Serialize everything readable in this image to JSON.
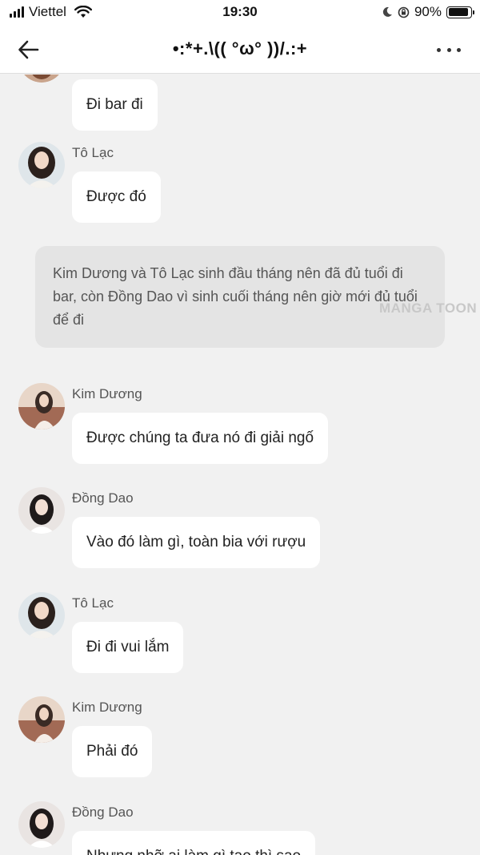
{
  "status_bar": {
    "carrier": "Viettel",
    "time": "19:30",
    "battery": "90%",
    "battery_level": 0.9
  },
  "header": {
    "title": "•:*+.\\(( °ω° ))/.:+"
  },
  "messages": [
    {
      "sender": "",
      "text": "Đi bar đi"
    },
    {
      "sender": "Tô Lạc",
      "text": "Được đó"
    },
    {
      "narration": "Kim Dương và Tô Lạc sinh đầu tháng nên đã đủ tuổi đi bar, còn Đồng Dao vì sinh cuối tháng nên giờ mới đủ tuổi để đi"
    },
    {
      "sender": "Kim Dương",
      "text": "Được chúng ta đưa nó đi giải ngố"
    },
    {
      "sender": "Đồng Dao",
      "text": "Vào đó làm gì, toàn bia với rượu"
    },
    {
      "sender": "Tô Lạc",
      "text": "Đi đi vui lắm"
    },
    {
      "sender": "Kim Dương",
      "text": "Phải đó"
    },
    {
      "sender": "Đồng Dao",
      "text": "Nhưng nhỡ ai làm gì tao thì sao"
    }
  ],
  "watermark": "MANGA TOON",
  "colors": {
    "background": "#f1f1f1",
    "bubble": "#ffffff",
    "narration": "#e4e4e4"
  }
}
